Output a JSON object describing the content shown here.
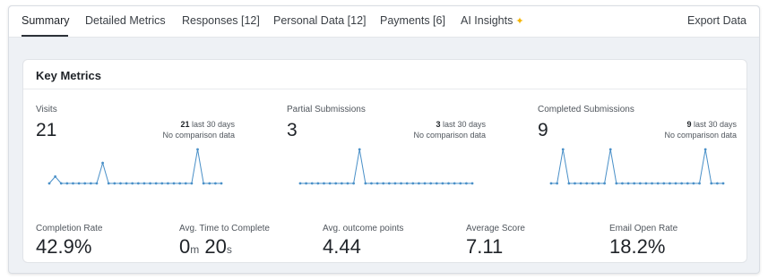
{
  "tabs": [
    {
      "label": "Summary",
      "active": true
    },
    {
      "label": "Detailed Metrics"
    },
    {
      "label": "Responses [12]"
    },
    {
      "label": "Personal Data [12]"
    },
    {
      "label": "Payments [6]"
    },
    {
      "label": "AI Insights"
    }
  ],
  "export_label": "Export Data",
  "card": {
    "title": "Key Metrics",
    "top_metrics": [
      {
        "label": "Visits",
        "value": "21",
        "period_value": "21",
        "period_label": "last 30 days",
        "comparison": "No comparison data",
        "sparkline": [
          0,
          1,
          0,
          0,
          0,
          0,
          0,
          0,
          0,
          3,
          0,
          0,
          0,
          0,
          0,
          0,
          0,
          0,
          0,
          0,
          0,
          0,
          0,
          0,
          0,
          5,
          0,
          0,
          0,
          0
        ]
      },
      {
        "label": "Partial Submissions",
        "value": "3",
        "period_value": "3",
        "period_label": "last 30 days",
        "comparison": "No comparison data",
        "sparkline": [
          0,
          0,
          0,
          0,
          0,
          0,
          0,
          0,
          0,
          0,
          1,
          0,
          0,
          0,
          0,
          0,
          0,
          0,
          0,
          0,
          0,
          0,
          0,
          0,
          0,
          0,
          0,
          0,
          0,
          0
        ]
      },
      {
        "label": "Completed Submissions",
        "value": "9",
        "period_value": "9",
        "period_label": "last 30 days",
        "comparison": "No comparison data",
        "sparkline": [
          0,
          0,
          1,
          0,
          0,
          0,
          0,
          0,
          0,
          0,
          1,
          0,
          0,
          0,
          0,
          0,
          0,
          0,
          0,
          0,
          0,
          0,
          0,
          0,
          0,
          0,
          1,
          0,
          0,
          0
        ]
      }
    ],
    "bottom_metrics": [
      {
        "label": "Completion Rate",
        "value": "42.9%"
      },
      {
        "label": "Avg. Time to Complete",
        "minutes": "0",
        "min_unit": "m",
        "seconds": "20",
        "sec_unit": "s"
      },
      {
        "label": "Avg. outcome points",
        "value": "4.44"
      },
      {
        "label": "Average Score",
        "value": "7.11"
      },
      {
        "label": "Email Open Rate",
        "value": "18.2%"
      }
    ]
  },
  "colors": {
    "accent": "#4a90c8",
    "text": "#1f2328",
    "muted": "#50565d"
  }
}
